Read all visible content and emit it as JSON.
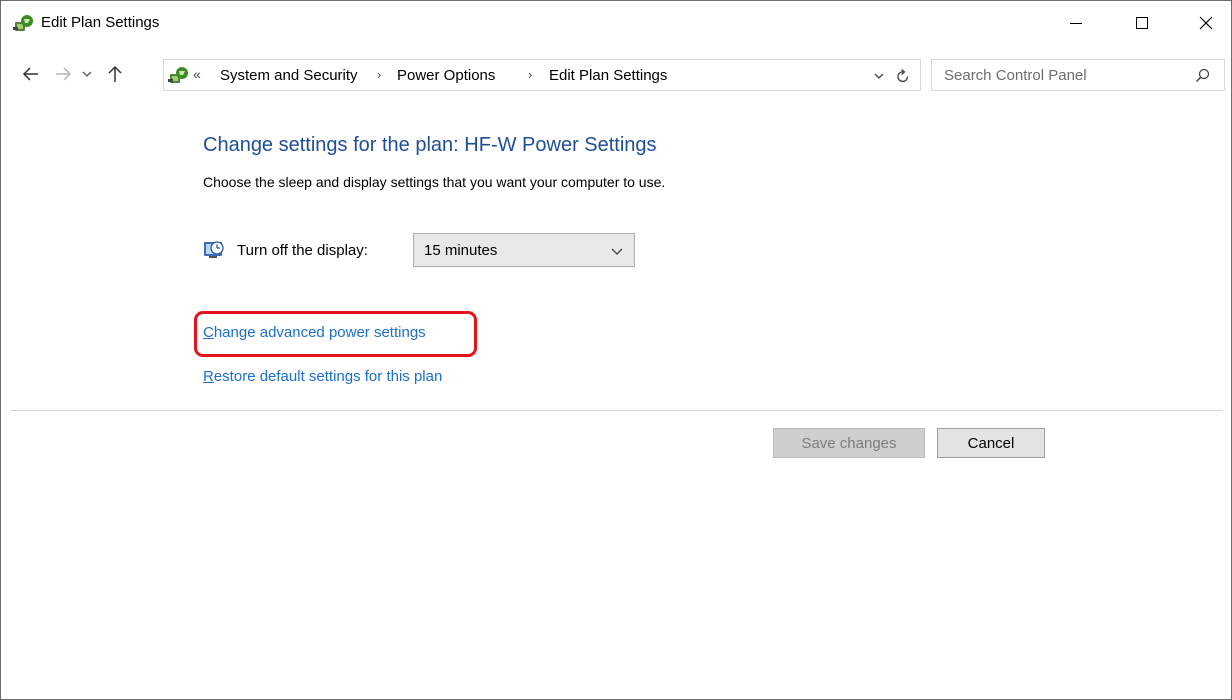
{
  "window": {
    "title": "Edit Plan Settings"
  },
  "address_bar": {
    "overflow": "«",
    "crumbs": [
      "System and Security",
      "Power Options",
      "Edit Plan Settings"
    ],
    "separator": "›"
  },
  "search": {
    "placeholder": "Search Control Panel"
  },
  "main": {
    "heading": "Change settings for the plan: HF-W Power Settings",
    "subtext": "Choose the sleep and display settings that you want your computer to use.",
    "display_setting": {
      "label": "Turn off the display:",
      "selected": "15 minutes"
    },
    "links": {
      "advanced_first": "C",
      "advanced_rest": "hange advanced power settings",
      "restore_first": "R",
      "restore_rest": "estore default settings for this plan"
    },
    "highlight_color": "#e3141a"
  },
  "footer": {
    "save_label": "Save changes",
    "cancel_label": "Cancel"
  },
  "colors": {
    "heading": "#1e4e9a",
    "link": "#1a6fd1"
  }
}
